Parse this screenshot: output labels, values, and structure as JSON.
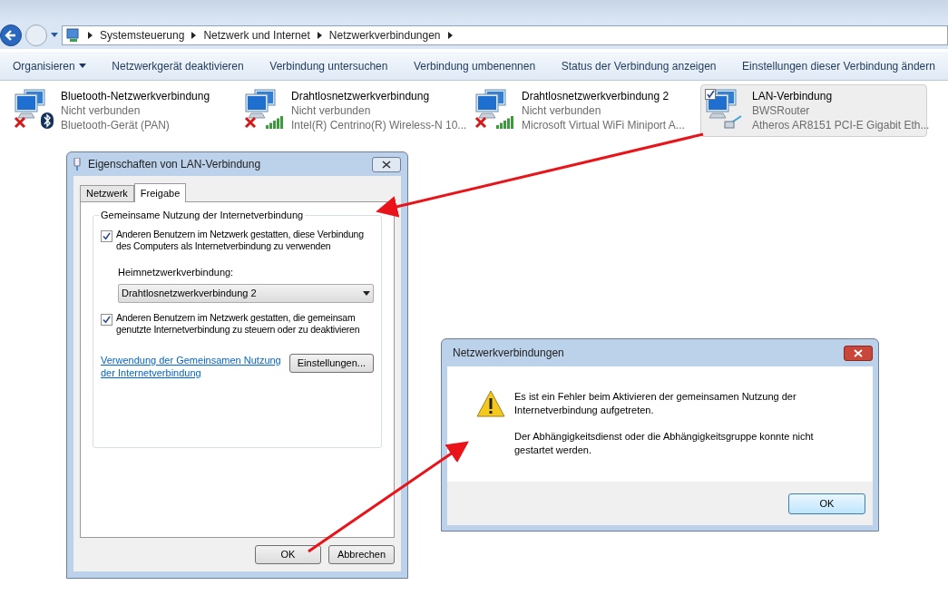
{
  "nav": {
    "breadcrumb": [
      "Systemsteuerung",
      "Netzwerk und Internet",
      "Netzwerkverbindungen"
    ]
  },
  "toolbar": [
    {
      "label": "Organisieren",
      "kind": "menu"
    },
    {
      "label": "Netzwerkgerät deaktivieren",
      "kind": "command"
    },
    {
      "label": "Verbindung untersuchen",
      "kind": "command"
    },
    {
      "label": "Verbindung umbenennen",
      "kind": "command"
    },
    {
      "label": "Status der Verbindung anzeigen",
      "kind": "command"
    },
    {
      "label": "Einstellungen dieser Verbindung ändern",
      "kind": "command"
    }
  ],
  "connections": [
    {
      "name": "Bluetooth-Netzwerkverbindung",
      "status": "Nicht verbunden",
      "device": "Bluetooth-Gerät (PAN)",
      "kind": "bluetooth",
      "disconnected": true,
      "selected": false
    },
    {
      "name": "Drahtlosnetzwerkverbindung",
      "status": "Nicht verbunden",
      "device": "Intel(R) Centrino(R) Wireless-N 10...",
      "kind": "wireless",
      "disconnected": true,
      "selected": false
    },
    {
      "name": "Drahtlosnetzwerkverbindung 2",
      "status": "Nicht verbunden",
      "device": "Microsoft Virtual WiFi Miniport A...",
      "kind": "wireless",
      "disconnected": true,
      "selected": false
    },
    {
      "name": "LAN-Verbindung",
      "status": "BWSRouter",
      "device": "Atheros AR8151 PCI-E Gigabit Eth...",
      "kind": "cable",
      "disconnected": false,
      "selected": true
    }
  ],
  "properties_dialog": {
    "title": "Eigenschaften von LAN-Verbindung",
    "tabs": [
      {
        "label": "Netzwerk",
        "selected": false
      },
      {
        "label": "Freigabe",
        "selected": true
      }
    ],
    "group_title": "Gemeinsame Nutzung der Internetverbindung",
    "allow_sharing": {
      "label": "Anderen Benutzern im Netzwerk gestatten, diese Verbindung des Computers als Internetverbindung zu verwenden",
      "checked": true
    },
    "home_network_label": "Heimnetzwerkverbindung:",
    "home_network_value": "Drahtlosnetzwerkverbindung 2",
    "allow_control": {
      "label": "Anderen Benutzern im Netzwerk gestatten, die gemeinsam genutzte Internetverbindung zu steuern oder zu deaktivieren",
      "checked": true
    },
    "help_link": "Verwendung der Gemeinsamen Nutzung der Internetverbindung",
    "settings_button": "Einstellungen...",
    "buttons": [
      "OK",
      "Abbrechen"
    ]
  },
  "error_dialog": {
    "title": "Netzwerkverbindungen",
    "messages": [
      "Es ist ein Fehler beim Aktivieren der gemeinsamen Nutzung der Internetverbindung aufgetreten.",
      "Der Abhängigkeitsdienst oder die Abhängigkeitsgruppe konnte nicht gestartet werden."
    ],
    "button": "OK"
  }
}
